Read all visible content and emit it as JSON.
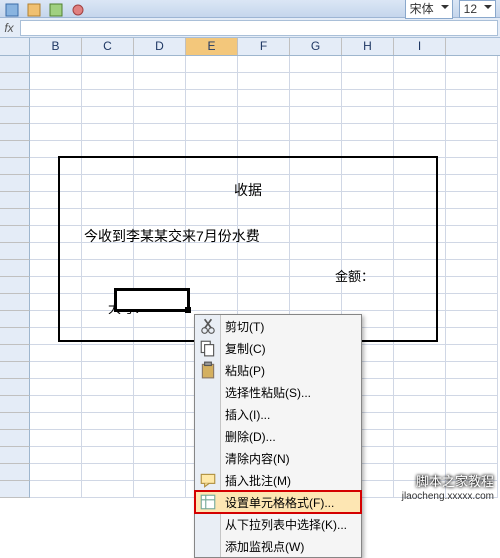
{
  "toolbar": {
    "font_name": "宋体",
    "font_size": "12"
  },
  "formula_bar": {
    "fx_label": "fx"
  },
  "columns": [
    "B",
    "C",
    "D",
    "E",
    "F",
    "G",
    "H",
    "I"
  ],
  "selected_column": "E",
  "receipt": {
    "title": "收据",
    "line1": "今收到李某某交来7月份水费",
    "amount_label": "金额：",
    "daxie_label": "大写："
  },
  "context_menu": {
    "items": [
      {
        "label": "剪切(T)",
        "icon": "cut"
      },
      {
        "label": "复制(C)",
        "icon": "copy"
      },
      {
        "label": "粘贴(P)",
        "icon": "paste"
      },
      {
        "label": "选择性粘贴(S)...",
        "icon": ""
      },
      {
        "label": "插入(I)...",
        "icon": ""
      },
      {
        "label": "删除(D)...",
        "icon": ""
      },
      {
        "label": "清除内容(N)",
        "icon": ""
      },
      {
        "label": "插入批注(M)",
        "icon": "comment"
      },
      {
        "label": "设置单元格格式(F)...",
        "icon": "format",
        "highlighted": true
      },
      {
        "label": "从下拉列表中选择(K)...",
        "icon": ""
      },
      {
        "label": "添加监视点(W)",
        "icon": ""
      }
    ]
  },
  "watermark": {
    "main": "脚本之家教程",
    "url": "jlaocheng.xxxxx.com"
  }
}
